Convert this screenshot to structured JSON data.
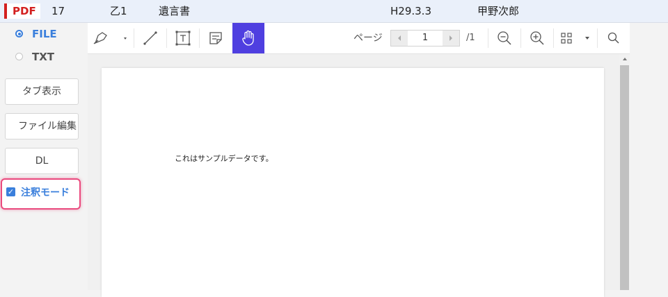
{
  "header": {
    "badge": "PDF",
    "number": "17",
    "party": "乙1",
    "doc_type": "遺言書",
    "date": "H29.3.3",
    "person": "甲野次郎"
  },
  "sidebar": {
    "radio_file": "FILE",
    "radio_txt": "TXT",
    "tab_display_button": "タブ表示",
    "file_edit_button": "ファイル編集",
    "download_button": "DL",
    "annotation_mode_label": "注釈モード"
  },
  "toolbar": {
    "page_label": "ページ",
    "page_current": "1",
    "page_total": "/1"
  },
  "document": {
    "text": "これはサンプルデータです。"
  },
  "colors": {
    "accent": "#3a7fdc",
    "active_tool": "#4f3fe0",
    "highlight": "#ea4a7e",
    "pdf_red": "#d32020"
  },
  "icons": [
    "pen-icon",
    "line-icon",
    "text-box-icon",
    "note-icon",
    "hand-icon",
    "zoom-out-icon",
    "zoom-in-icon",
    "grid-icon",
    "search-icon"
  ]
}
